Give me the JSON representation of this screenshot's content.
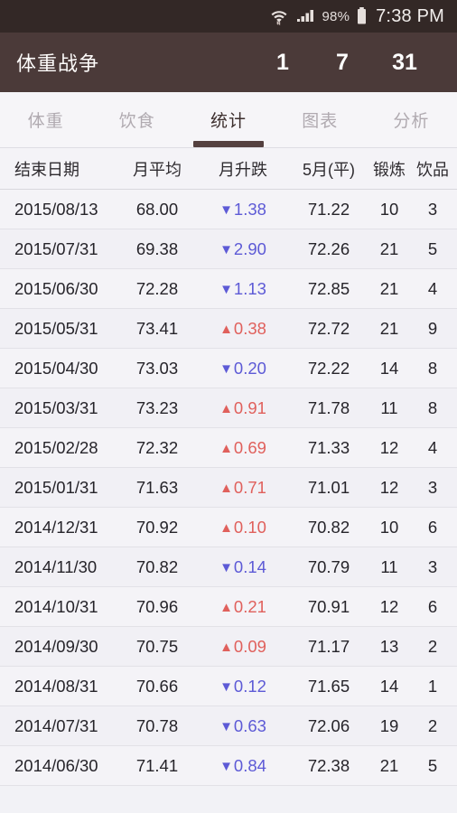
{
  "status_bar": {
    "wifi_icon": "wifi-icon",
    "signal_icon": "signal-icon",
    "battery_percent": "98%",
    "battery_icon": "battery-icon",
    "time": "7:38 PM"
  },
  "app_bar": {
    "title": "体重战争",
    "actions": [
      {
        "label": "1",
        "name": "range-day-button"
      },
      {
        "label": "7",
        "name": "range-week-button"
      },
      {
        "label": "31",
        "name": "range-month-button"
      }
    ]
  },
  "tabs": [
    {
      "label": "体重",
      "active": false
    },
    {
      "label": "饮食",
      "active": false
    },
    {
      "label": "统计",
      "active": true
    },
    {
      "label": "图表",
      "active": false
    },
    {
      "label": "分析",
      "active": false
    }
  ],
  "table": {
    "columns": [
      "结束日期",
      "月平均",
      "月升跌",
      "5月(平)",
      "锻炼",
      "饮品"
    ],
    "rows": [
      {
        "date": "2015/08/13",
        "avg": "68.00",
        "dir": "down",
        "tri": "▼",
        "delta": "1.38",
        "prev": "71.22",
        "exercise": "10",
        "drinks": "3"
      },
      {
        "date": "2015/07/31",
        "avg": "69.38",
        "dir": "down",
        "tri": "▼",
        "delta": "2.90",
        "prev": "72.26",
        "exercise": "21",
        "drinks": "5"
      },
      {
        "date": "2015/06/30",
        "avg": "72.28",
        "dir": "down",
        "tri": "▼",
        "delta": "1.13",
        "prev": "72.85",
        "exercise": "21",
        "drinks": "4"
      },
      {
        "date": "2015/05/31",
        "avg": "73.41",
        "dir": "up",
        "tri": "▲",
        "delta": "0.38",
        "prev": "72.72",
        "exercise": "21",
        "drinks": "9"
      },
      {
        "date": "2015/04/30",
        "avg": "73.03",
        "dir": "down",
        "tri": "▼",
        "delta": "0.20",
        "prev": "72.22",
        "exercise": "14",
        "drinks": "8"
      },
      {
        "date": "2015/03/31",
        "avg": "73.23",
        "dir": "up",
        "tri": "▲",
        "delta": "0.91",
        "prev": "71.78",
        "exercise": "11",
        "drinks": "8"
      },
      {
        "date": "2015/02/28",
        "avg": "72.32",
        "dir": "up",
        "tri": "▲",
        "delta": "0.69",
        "prev": "71.33",
        "exercise": "12",
        "drinks": "4"
      },
      {
        "date": "2015/01/31",
        "avg": "71.63",
        "dir": "up",
        "tri": "▲",
        "delta": "0.71",
        "prev": "71.01",
        "exercise": "12",
        "drinks": "3"
      },
      {
        "date": "2014/12/31",
        "avg": "70.92",
        "dir": "up",
        "tri": "▲",
        "delta": "0.10",
        "prev": "70.82",
        "exercise": "10",
        "drinks": "6"
      },
      {
        "date": "2014/11/30",
        "avg": "70.82",
        "dir": "down",
        "tri": "▼",
        "delta": "0.14",
        "prev": "70.79",
        "exercise": "11",
        "drinks": "3"
      },
      {
        "date": "2014/10/31",
        "avg": "70.96",
        "dir": "up",
        "tri": "▲",
        "delta": "0.21",
        "prev": "70.91",
        "exercise": "12",
        "drinks": "6"
      },
      {
        "date": "2014/09/30",
        "avg": "70.75",
        "dir": "up",
        "tri": "▲",
        "delta": "0.09",
        "prev": "71.17",
        "exercise": "13",
        "drinks": "2"
      },
      {
        "date": "2014/08/31",
        "avg": "70.66",
        "dir": "down",
        "tri": "▼",
        "delta": "0.12",
        "prev": "71.65",
        "exercise": "14",
        "drinks": "1"
      },
      {
        "date": "2014/07/31",
        "avg": "70.78",
        "dir": "down",
        "tri": "▼",
        "delta": "0.63",
        "prev": "72.06",
        "exercise": "19",
        "drinks": "2"
      },
      {
        "date": "2014/06/30",
        "avg": "71.41",
        "dir": "down",
        "tri": "▼",
        "delta": "0.84",
        "prev": "72.38",
        "exercise": "21",
        "drinks": "5"
      }
    ]
  },
  "colors": {
    "status_bar": "#332826",
    "app_bar": "#4b3a39",
    "tab_active": "#3d2f2e",
    "tab_inactive": "#b0aab0",
    "underline": "#54403f",
    "up": "#e0605c",
    "down": "#5d5ad6",
    "page_bg": "#f4f3f7"
  }
}
